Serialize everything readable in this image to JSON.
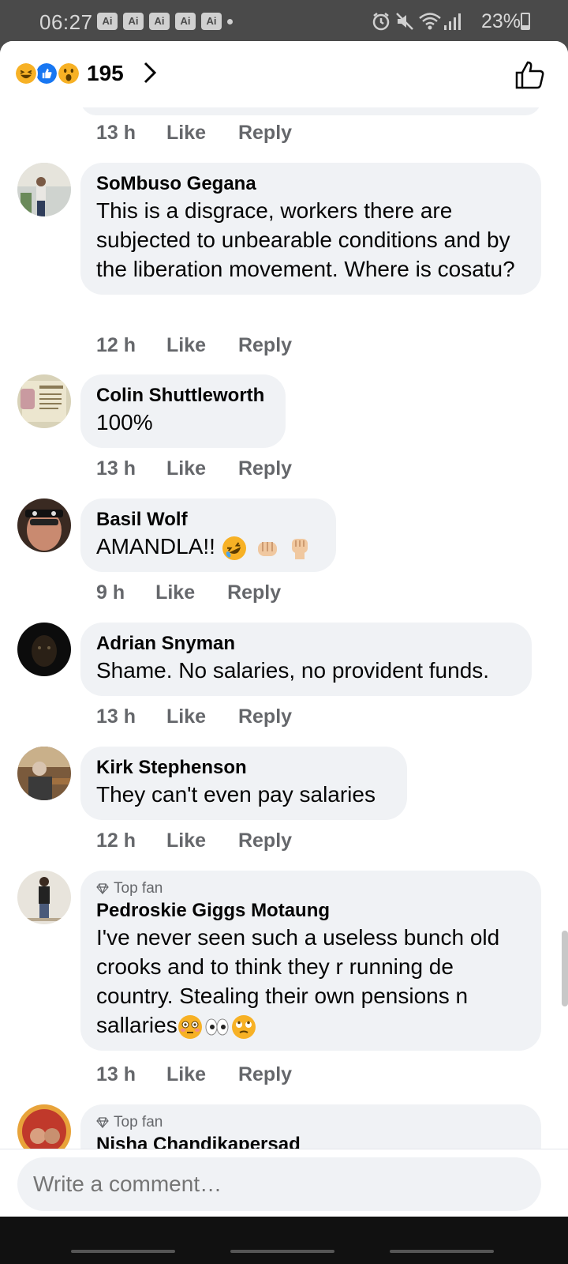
{
  "status": {
    "time": "06:27",
    "ai_badges": [
      "Ai",
      "Ai",
      "Ai",
      "Ai",
      "Ai"
    ],
    "battery": "23%",
    "battery_level": 0.23
  },
  "header": {
    "reaction_count": "195",
    "reactions": [
      "haha",
      "like",
      "wow"
    ]
  },
  "comments": [
    {
      "meta": {
        "time": "13 h",
        "like": "Like",
        "reply": "Reply"
      }
    },
    {
      "author": "SoMbuso Gegana",
      "text": "This is a disgrace, workers there are subjected to unbearable conditions and by the liberation movement. Where is cosatu?",
      "meta": {
        "time": "12 h",
        "like": "Like",
        "reply": "Reply"
      }
    },
    {
      "author": "Colin Shuttleworth",
      "text": "100%",
      "meta": {
        "time": "13 h",
        "like": "Like",
        "reply": "Reply"
      }
    },
    {
      "author": "Basil Wolf",
      "text": "AMANDLA!!",
      "emojis": [
        "rofl",
        "fist-bump",
        "raised-fist"
      ],
      "meta": {
        "time": "9 h",
        "like": "Like",
        "reply": "Reply"
      }
    },
    {
      "author": "Adrian Snyman",
      "text": "Shame. No salaries, no provident funds.",
      "meta": {
        "time": "13 h",
        "like": "Like",
        "reply": "Reply"
      }
    },
    {
      "author": "Kirk Stephenson",
      "text": "They can't even pay salaries",
      "meta": {
        "time": "12 h",
        "like": "Like",
        "reply": "Reply"
      }
    },
    {
      "badge": "Top fan",
      "author": "Pedroskie Giggs Motaung",
      "text_lines": [
        "I've never seen such a useless bunch old",
        "crooks and to think they r running de",
        "country. Stealing their own pensions n",
        "sallaries"
      ],
      "emojis": [
        "flushed",
        "eyes",
        "rolling-eyes"
      ],
      "meta": {
        "time": "13 h",
        "like": "Like",
        "reply": "Reply"
      }
    },
    {
      "badge": "Top fan",
      "author": "Nisha Chandikapersad"
    }
  ],
  "composer": {
    "placeholder": "Write a comment…"
  }
}
